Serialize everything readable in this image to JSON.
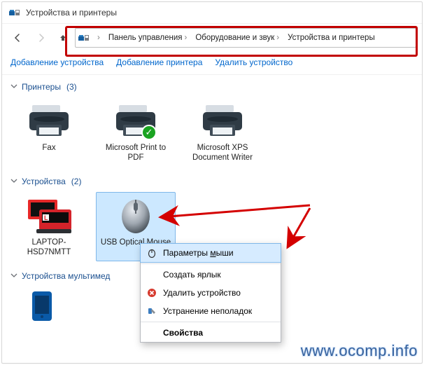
{
  "window": {
    "title": "Устройства и принтеры"
  },
  "breadcrumb": {
    "items": [
      {
        "label": "Панель управления"
      },
      {
        "label": "Оборудование и звук"
      },
      {
        "label": "Устройства и принтеры"
      }
    ]
  },
  "toolbar": {
    "add_device": "Добавление устройства",
    "add_printer": "Добавление принтера",
    "remove_device": "Удалить устройство"
  },
  "groups": {
    "printers_label": "Принтеры",
    "printers_count": "(3)",
    "devices_label": "Устройства",
    "devices_count": "(2)",
    "multimedia_label": "Устройства мультимед"
  },
  "devices": {
    "fax": "Fax",
    "ms_pdf": "Microsoft Print to PDF",
    "ms_xps": "Microsoft XPS Document Writer",
    "laptop": "LAPTOP-HSD7NMTT",
    "mouse": "USB Optical Mouse"
  },
  "context_menu": {
    "mouse_settings": "Параметры мыши",
    "mouse_settings_underline_char": "м",
    "create_shortcut": "Создать ярлык",
    "remove": "Удалить устройство",
    "troubleshoot": "Устранение неполадок",
    "properties": "Свойства"
  },
  "watermark": "www.ocomp.info"
}
